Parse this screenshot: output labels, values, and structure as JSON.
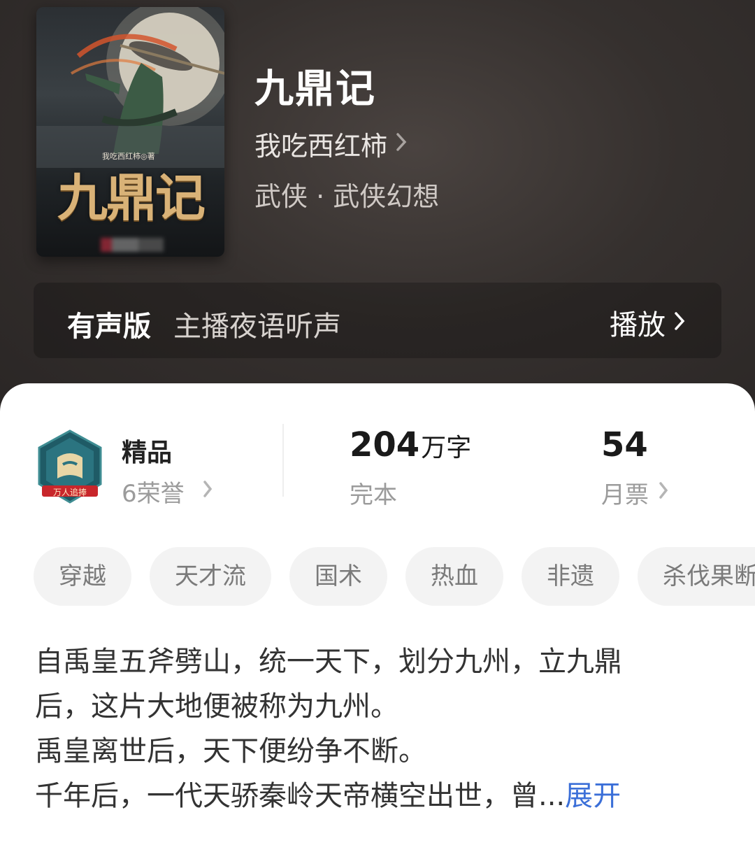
{
  "header": {
    "cover": {
      "title": "九鼎记",
      "author_caption": "我吃西红柿◎著"
    },
    "book_title": "九鼎记",
    "author": "我吃西红柿",
    "genre": "武侠 · 武侠幻想",
    "audio": {
      "label": "有声版",
      "host": "主播夜语听声",
      "play_label": "播放"
    }
  },
  "stats": {
    "quality": "精品",
    "honors": "6荣誉",
    "badge_caption": "万人追捧",
    "words_number": "204",
    "words_unit": "万字",
    "status": "完本",
    "monthly_votes": "54",
    "monthly_votes_label": "月票"
  },
  "tags": [
    "穿越",
    "天才流",
    "国术",
    "热血",
    "非遗",
    "杀伐果断"
  ],
  "synopsis": {
    "lines": [
      "自禹皇五斧劈山，统一天下，划分九州，立九鼎",
      "后，这片大地便被称为九州。",
      "禹皇离世后，天下便纷争不断。",
      "千年后，一代天骄秦岭天帝横空出世，曾..."
    ],
    "expand_label": "展开"
  },
  "colors": {
    "link": "#3b6fd8",
    "header_bg": "#35302e",
    "cover_title": "#d9b277"
  },
  "icons": [
    "chevron-right-icon",
    "quality-badge-icon"
  ]
}
